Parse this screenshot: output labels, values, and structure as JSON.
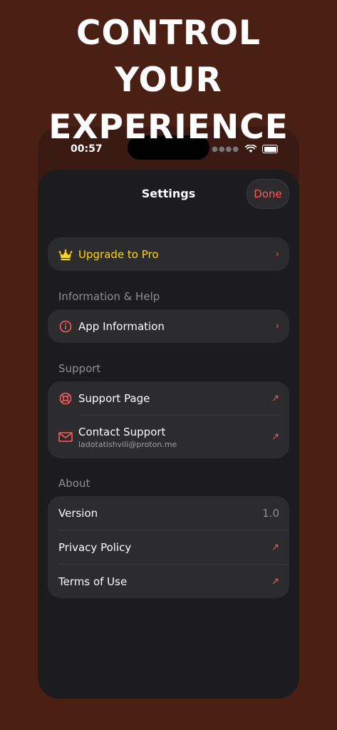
{
  "headline": {
    "line1": "CONTROL",
    "line2": "YOUR",
    "line3": "EXPERIENCE"
  },
  "status_bar": {
    "time": "00:57"
  },
  "nav": {
    "title": "Settings",
    "done_label": "Done"
  },
  "upgrade": {
    "label": "Upgrade to Pro",
    "icon": "crown-icon"
  },
  "info_help": {
    "section_title": "Information & Help",
    "items": [
      {
        "label": "App Information",
        "icon": "info-icon"
      }
    ]
  },
  "support": {
    "section_title": "Support",
    "items": [
      {
        "label": "Support Page",
        "icon": "lifebuoy-icon"
      },
      {
        "label": "Contact Support",
        "sublabel": "ladotatishvili@proton.me",
        "icon": "envelope-icon"
      }
    ]
  },
  "about": {
    "section_title": "About",
    "items": [
      {
        "label": "Version",
        "value": "1.0"
      },
      {
        "label": "Privacy Policy"
      },
      {
        "label": "Terms of Use"
      }
    ]
  },
  "colors": {
    "background": "#4a1f14",
    "sheet": "#1c1c1e",
    "card": "#2c2c2e",
    "accent_red": "#ff5a5a",
    "accent_gold": "#ffd60a",
    "secondary_text": "#8e8e93"
  }
}
